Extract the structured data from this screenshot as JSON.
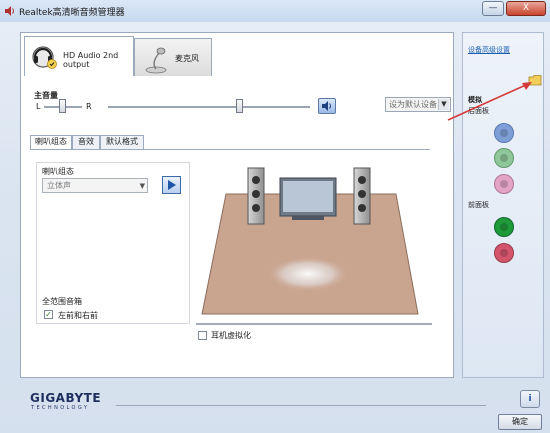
{
  "window": {
    "title": "Realtek高清晰音频管理器",
    "minimize_label": "—",
    "close_label": "X"
  },
  "device_tabs": [
    {
      "label": "HD Audio 2nd output",
      "icon": "speaker-headphone-icon",
      "active": true
    },
    {
      "label": "麦克风",
      "icon": "microphone-icon",
      "active": false
    }
  ],
  "volume": {
    "caption": "主音量",
    "left_label": "L",
    "right_label": "R",
    "balance_position": 0.5,
    "level": 0.63,
    "set_default_label": "设为默认设备"
  },
  "sub_tabs": [
    "喇叭组态",
    "音效",
    "默认格式"
  ],
  "speaker_config": {
    "label": "喇叭组态",
    "selected": "立体声",
    "full_range_label": "全范围音箱",
    "front_lr_label": "左前和右前",
    "front_lr_checked": true,
    "headphone_virtualization_label": "耳机虚拟化",
    "headphone_virtualization_checked": false
  },
  "side_panel": {
    "advanced_settings_link": "设备高级设置",
    "analog_label": "模拟",
    "back_panel_label": "后面板",
    "front_panel_label": "前面板",
    "back_jacks": [
      {
        "color": "#7e9ed8"
      },
      {
        "color": "#8fc79a"
      },
      {
        "color": "#e2a3c5"
      }
    ],
    "front_jacks": [
      {
        "color": "#1f9a3a"
      },
      {
        "color": "#d2556b"
      }
    ]
  },
  "footer": {
    "brand": "GIGABYTE",
    "brand_sub": "TECHNOLOGY",
    "ok_label": "确定",
    "info_label": "i"
  },
  "colors": {
    "floor": "#c9a48e",
    "annotation_arrow": "#d43a3a"
  }
}
